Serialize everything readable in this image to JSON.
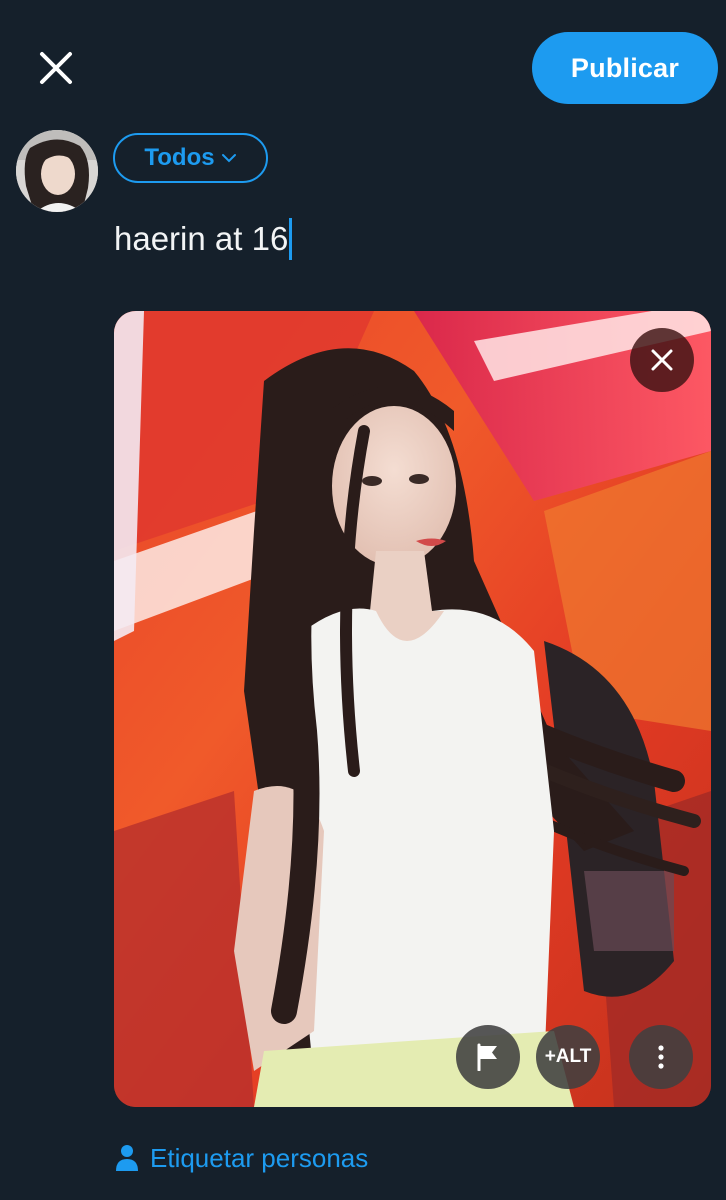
{
  "header": {
    "close_icon": "close-icon",
    "publish_label": "Publicar"
  },
  "composer": {
    "avatar_icon": "profile-avatar",
    "audience_label": "Todos",
    "audience_icon": "chevron-down-icon",
    "text": "haerin at 16"
  },
  "media": {
    "remove_icon": "close-icon",
    "flag_icon": "flag-icon",
    "alt_label": "+ALT",
    "more_icon": "more-vertical-icon"
  },
  "footer": {
    "tag_label": "Etiquetar personas",
    "tag_icon": "person-icon"
  },
  "colors": {
    "background": "#15202b",
    "accent": "#1d9bf0",
    "text": "#e7e9ea"
  }
}
